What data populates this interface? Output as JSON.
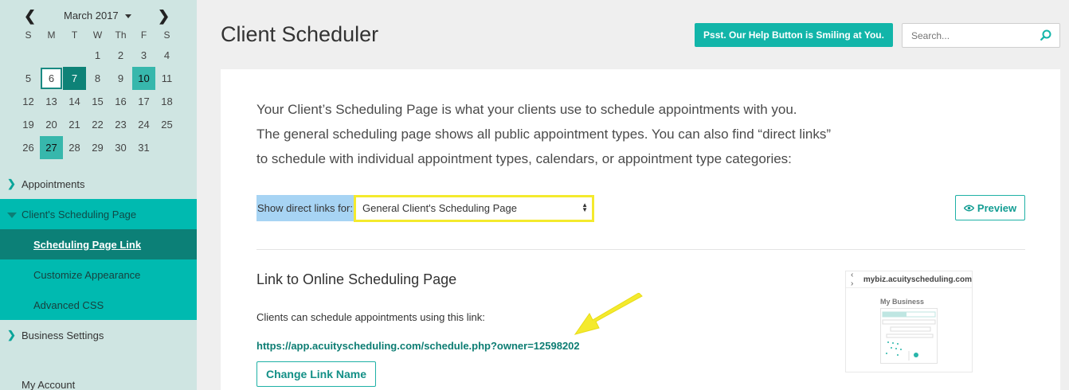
{
  "calendar": {
    "month_label": "March 2017",
    "weekdays": [
      "S",
      "M",
      "T",
      "W",
      "Th",
      "F",
      "S"
    ],
    "weeks": [
      [
        "",
        "",
        "",
        "1",
        "2",
        "3",
        "4"
      ],
      [
        "5",
        "6",
        "7",
        "8",
        "9",
        "10",
        "11"
      ],
      [
        "12",
        "13",
        "14",
        "15",
        "16",
        "17",
        "18"
      ],
      [
        "19",
        "20",
        "21",
        "22",
        "23",
        "24",
        "25"
      ],
      [
        "26",
        "27",
        "28",
        "29",
        "30",
        "31",
        ""
      ]
    ],
    "today": "6",
    "selected_dark": [
      "7"
    ],
    "selected_light": [
      "10",
      "27"
    ]
  },
  "sidebar": {
    "items": [
      {
        "label": "Appointments"
      },
      {
        "label": "Client's Scheduling Page"
      },
      {
        "label": "Scheduling Page Link"
      },
      {
        "label": "Customize Appearance"
      },
      {
        "label": "Advanced CSS"
      },
      {
        "label": "Business Settings"
      },
      {
        "label": "My Account"
      }
    ]
  },
  "header": {
    "title": "Client Scheduler",
    "help_button": "Psst. Our Help Button is Smiling at You.",
    "search_placeholder": "Search..."
  },
  "intro": {
    "line1": "Your Client’s Scheduling Page is what your clients use to schedule appointments with you.",
    "line2": "The general scheduling page shows all public appointment types. You can also find “direct links”",
    "line3": "to schedule with individual appointment types, calendars, or appointment type categories:"
  },
  "direct_links": {
    "label": "Show direct links for:",
    "selected": "General Client's Scheduling Page",
    "preview_label": "Preview"
  },
  "link_section": {
    "title": "Link to Online Scheduling Page",
    "description": "Clients can schedule appointments using this link:",
    "url": "https://app.acuityscheduling.com/schedule.php?owner=12598202",
    "change_button": "Change Link Name"
  },
  "thumbnail": {
    "url": "mybiz.acuityscheduling.com",
    "business": "My Business"
  },
  "colors": {
    "accent": "#12b5a9",
    "sidebar_bg": "#cfe5e2",
    "nav_active": "#00bab0",
    "nav_current": "#0c8077",
    "highlight_yellow": "#f4ea2d"
  }
}
